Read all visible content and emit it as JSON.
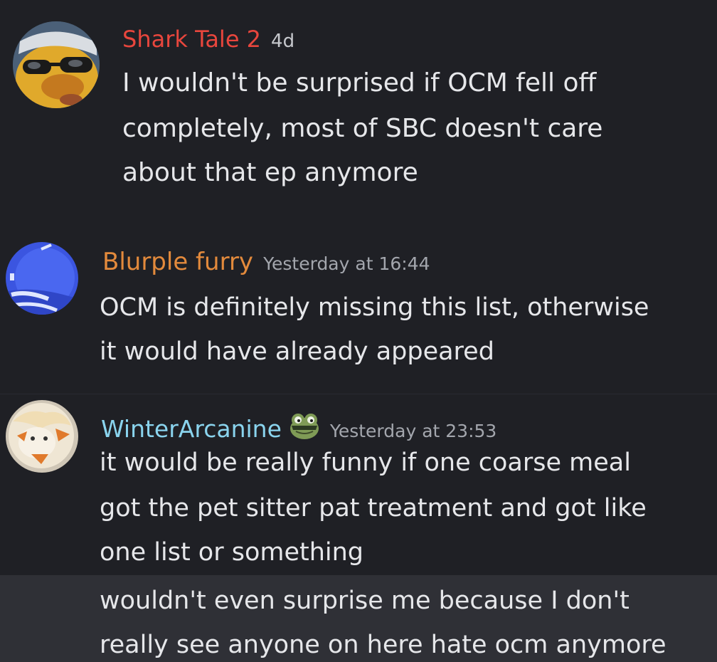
{
  "messages": [
    {
      "username": "Shark Tale 2",
      "username_color": "#e8463d",
      "timestamp": "4d",
      "lines": [
        "I wouldn't be surprised if OCM fell off",
        "completely, most of SBC doesn't care",
        "about that ep anymore"
      ]
    },
    {
      "username": "Blurple furry",
      "username_color": "#e38a3c",
      "timestamp": "Yesterday at 16:44",
      "lines": [
        "OCM is definitely missing this list, otherwise",
        "it would have already appeared"
      ]
    },
    {
      "username": "WinterArcanine",
      "username_color": "#8ad4ee",
      "timestamp": "Yesterday at 23:53",
      "role_icon": "frog-face-icon",
      "lines": [
        "it would be really funny if one coarse meal",
        "got the pet sitter pat treatment and got like",
        "one list or something"
      ]
    }
  ],
  "followup_message": {
    "lines": [
      "wouldn't even surprise me because I don't",
      "really see anyone on here hate ocm anymore"
    ]
  }
}
